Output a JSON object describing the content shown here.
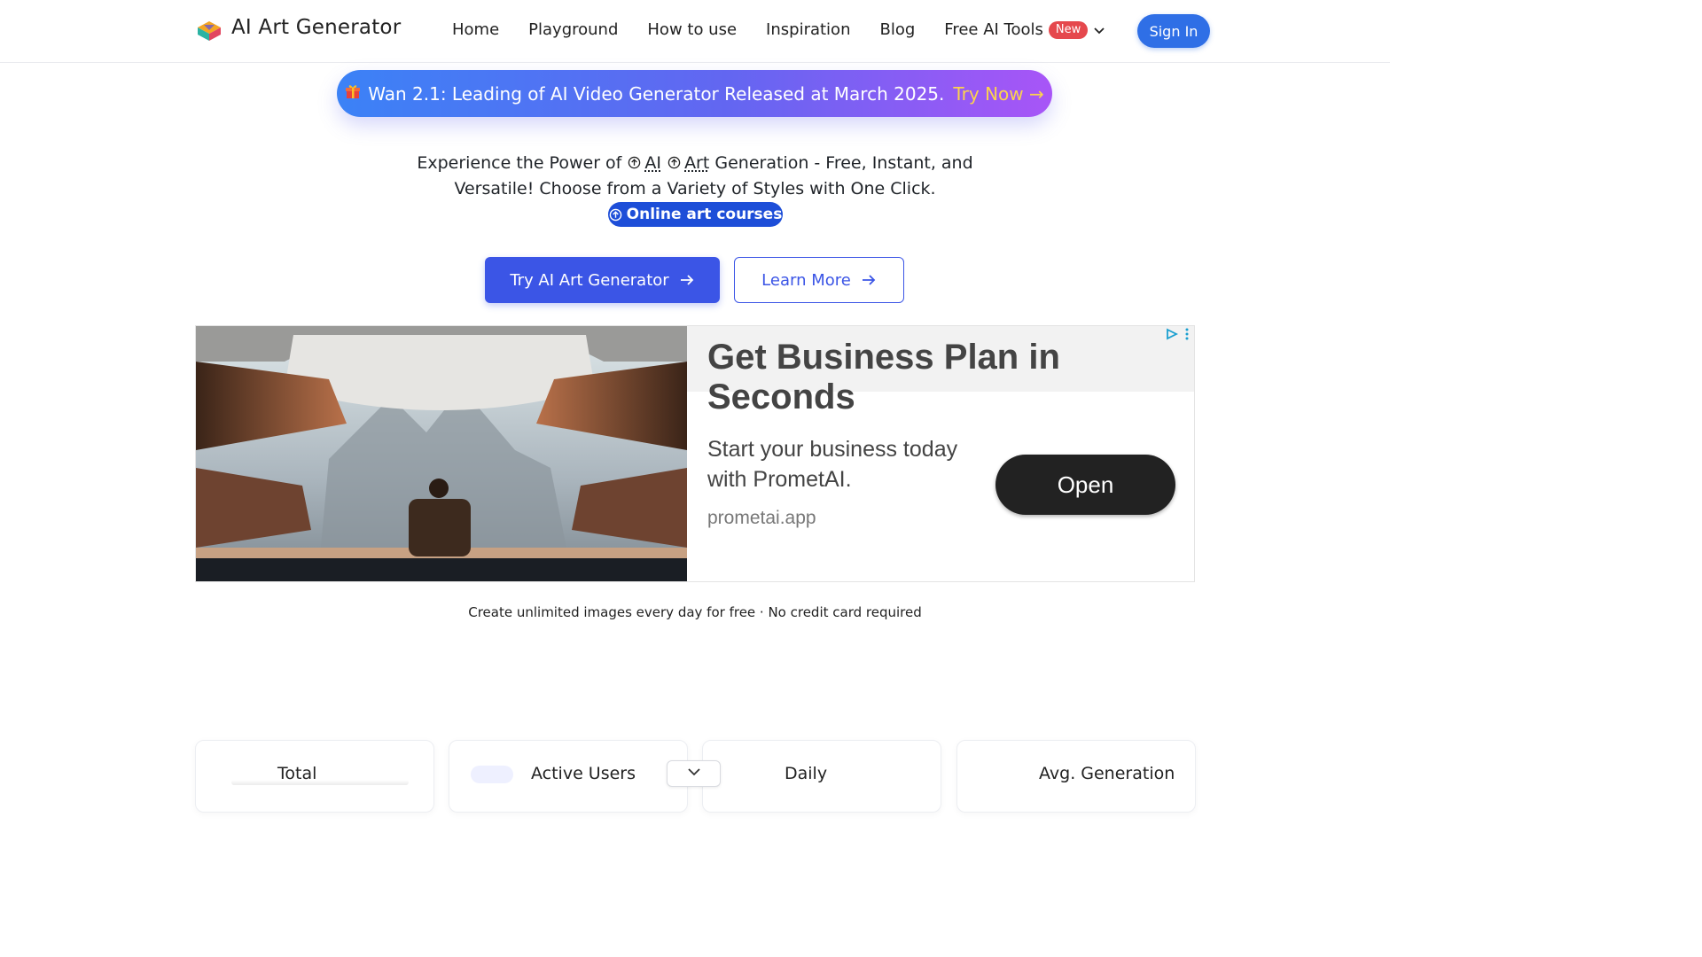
{
  "header": {
    "brand": "AI Art Generator",
    "nav": [
      "Home",
      "Playground",
      "How to use",
      "Inspiration",
      "Blog"
    ],
    "tools_label": "Free AI Tools",
    "new_badge": "New",
    "signin": "Sign In"
  },
  "banner": {
    "text": "Wan 2.1: Leading of AI Video Generator Released at March 2025.",
    "cta": "Try Now →"
  },
  "hero": {
    "line1_pre": "Experience the Power of",
    "ai": "AI",
    "art": "Art",
    "line1_post": "Generation - Free, Instant, and",
    "line2": "Versatile! Choose from a Variety of Styles with One Click.",
    "courses": "Online art courses"
  },
  "cta": {
    "primary": "Try AI Art Generator",
    "secondary": "Learn More"
  },
  "ad": {
    "title": "Get Business Plan in Seconds",
    "description": "Start your business today with PrometAI.",
    "url": "prometai.app",
    "button": "Open"
  },
  "note": "Create unlimited images every day for free · No credit card required",
  "stats": [
    "Total",
    "Active Users",
    "Daily",
    "Avg. Generation"
  ],
  "colors": {
    "primary": "#3b55e6",
    "signin": "#2f6fe6",
    "badge": "#e5484d",
    "banner_start": "#3b82f6",
    "banner_end": "#a855f7"
  }
}
